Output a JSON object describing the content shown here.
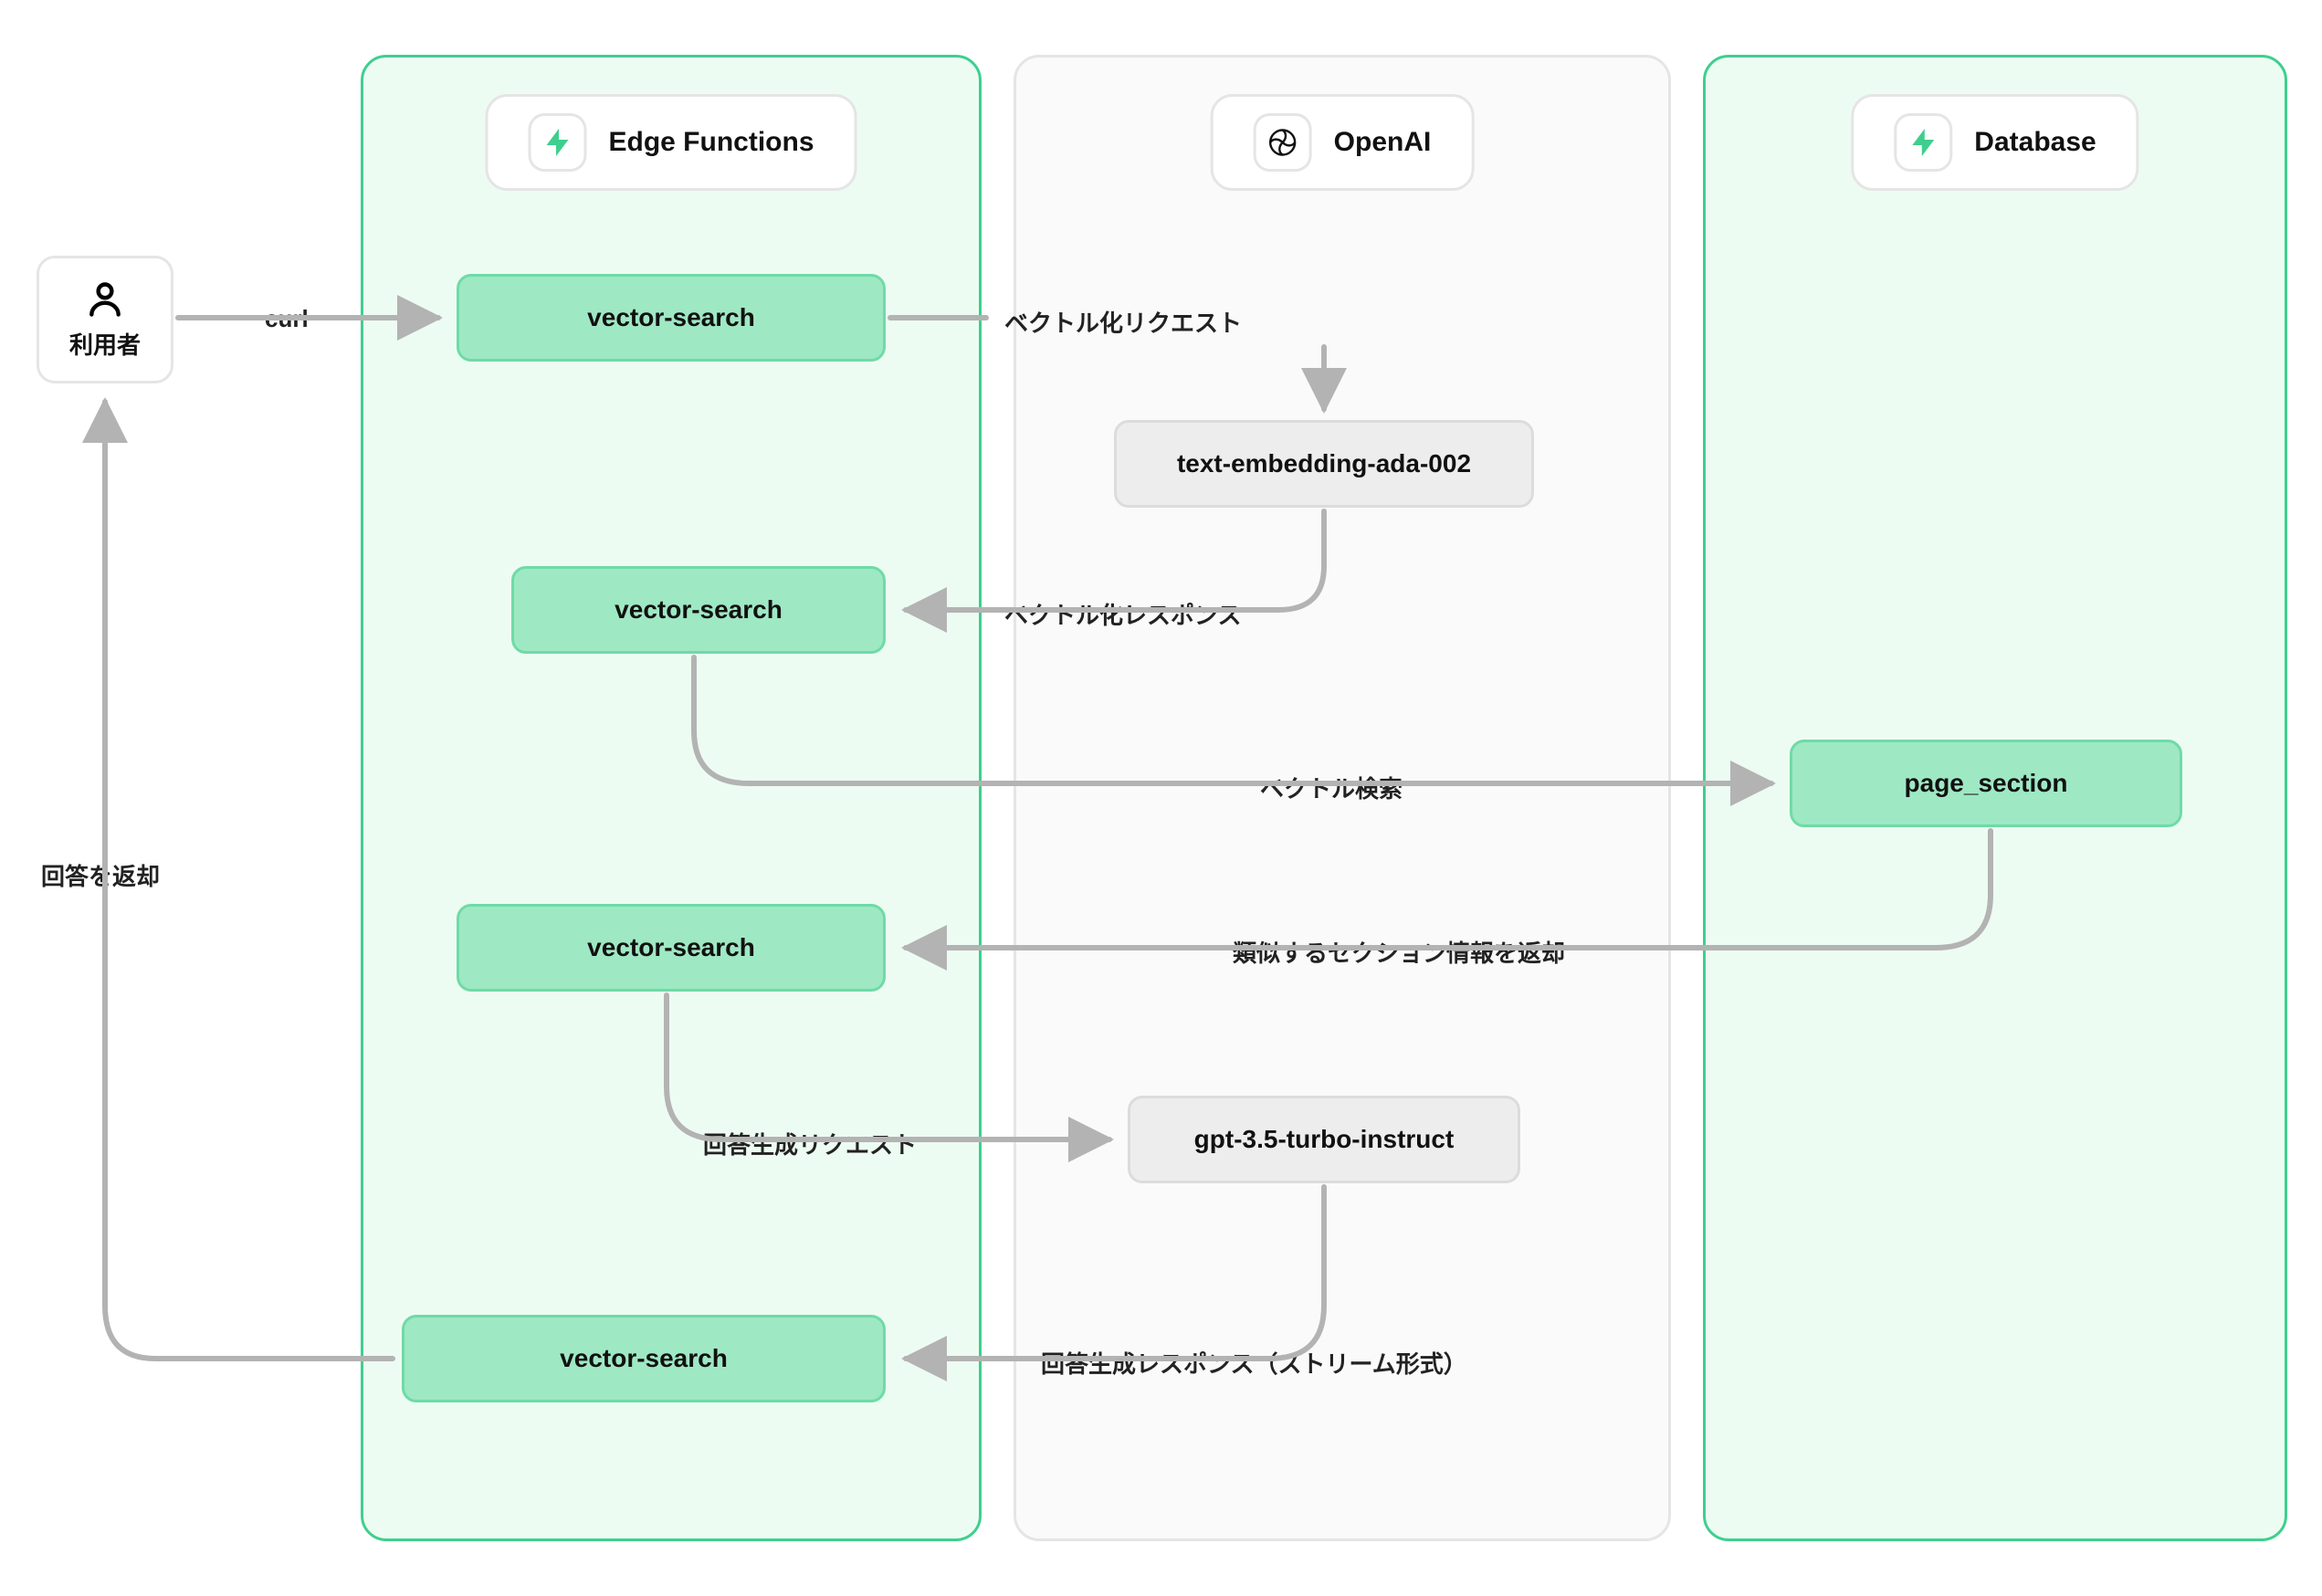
{
  "actor": {
    "label": "利用者"
  },
  "lanes": {
    "edge_functions": {
      "title": "Edge Functions"
    },
    "openai": {
      "title": "OpenAI"
    },
    "database": {
      "title": "Database"
    }
  },
  "nodes": {
    "vs1": "vector-search",
    "vs2": "vector-search",
    "vs3": "vector-search",
    "vs4": "vector-search",
    "embed_model": "text-embedding-ada-002",
    "chat_model": "gpt-3.5-turbo-instruct",
    "page_section": "page_section"
  },
  "edges": {
    "curl": "curl",
    "vec_req": "ベクトル化リクエスト",
    "vec_res": "ベクトル化レスポンス",
    "vec_search": "ベクトル検索",
    "similar_sections": "類似するセクション情報を返却",
    "ans_req": "回答生成リクエスト",
    "ans_res": "回答生成レスポンス（ストリーム形式）",
    "return_ans": "回答を返却"
  },
  "icons": {
    "user": "user-icon",
    "supabase": "supabase-icon",
    "openai": "openai-icon"
  }
}
